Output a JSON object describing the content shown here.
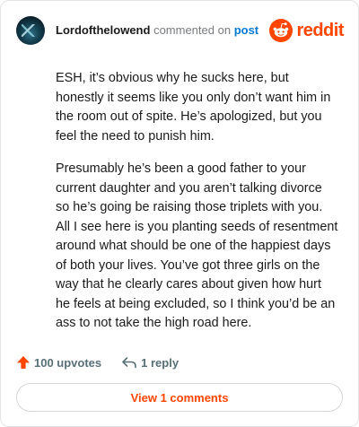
{
  "header": {
    "username": "Lordofthelowend",
    "commented_text": "commented on",
    "post_link": "post",
    "brand": "reddit"
  },
  "comment": {
    "paragraphs": [
      "ESH, it’s obvious why he sucks here, but honestly it seems like you only don’t want him in the room out of spite. He’s apologized, but you feel the need to punish him.",
      "Presumably he’s been a good father to your current daughter and you aren’t talking divorce so he’s going be raising those triplets with you. All I see here is you planting seeds of resentment around what should be one of the happiest days of both your lives. You’ve got three girls on the way that he clearly cares about given how hurt he feels at being excluded, so I think you’d be an ass to not take the high road here."
    ]
  },
  "actions": {
    "upvotes": "100 upvotes",
    "reply": "1 reply"
  },
  "view_button": "View 1 comments",
  "colors": {
    "brand": "#ff4500",
    "link": "#0079d3",
    "muted": "#787c7e"
  },
  "icons": {
    "upvote": "upvote-arrow-icon",
    "reply": "reply-arrow-icon",
    "logo": "reddit-snoo-icon"
  }
}
